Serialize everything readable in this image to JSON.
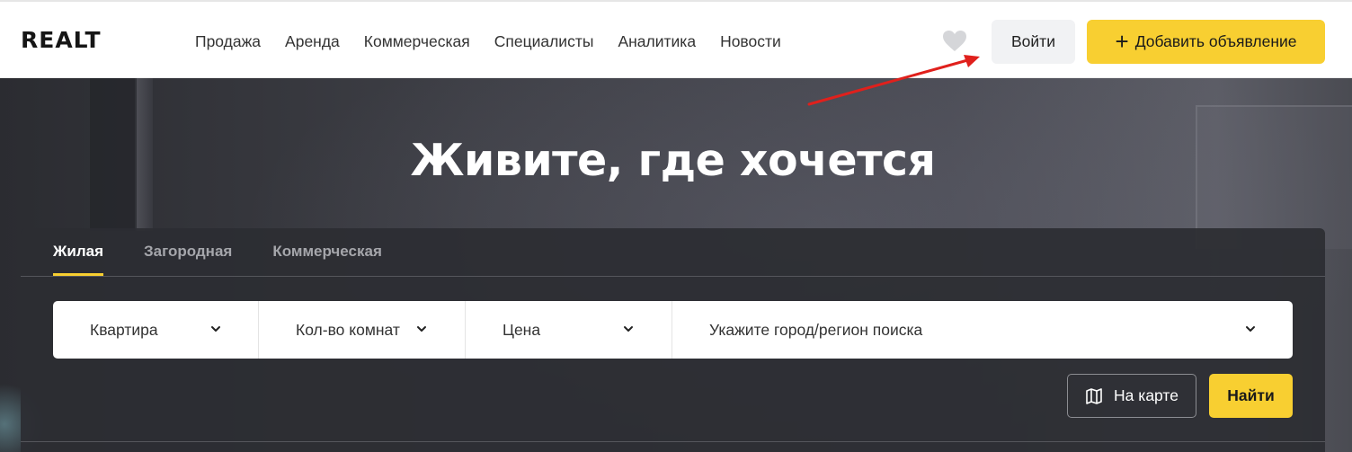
{
  "header": {
    "logo": "REALT",
    "nav": [
      "Продажа",
      "Аренда",
      "Коммерческая",
      "Специалисты",
      "Аналитика",
      "Новости"
    ],
    "favorites_icon": "heart-icon",
    "login_label": "Войти",
    "add_label": "Добавить объявление",
    "add_icon": "plus-icon"
  },
  "hero": {
    "title": "Живите, где хочется"
  },
  "search": {
    "tabs": [
      {
        "label": "Жилая",
        "active": true
      },
      {
        "label": "Загородная",
        "active": false
      },
      {
        "label": "Коммерческая",
        "active": false
      }
    ],
    "filters": {
      "property_type": "Квартира",
      "rooms": "Кол-во комнат",
      "price": "Цена",
      "location": "Укажите город/регион поиска"
    },
    "map_label": "На карте",
    "find_label": "Найти"
  },
  "colors": {
    "accent": "#f8cf31",
    "annotation": "#e0201c",
    "panel": "#2c2d33"
  }
}
